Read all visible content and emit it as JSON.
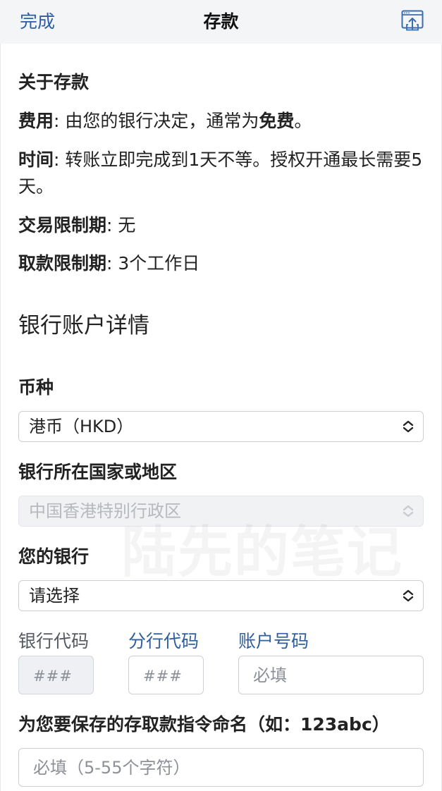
{
  "nav": {
    "done_label": "完成",
    "title": "存款",
    "share_icon": "share-icon"
  },
  "about": {
    "heading": "关于存款",
    "fee": {
      "label": "费用",
      "sep": ": ",
      "text_before": "由您的银行决定，通常为",
      "emphasis": "免费",
      "text_after": "。"
    },
    "time": {
      "label": "时间",
      "sep": ": ",
      "text": "转账立即完成到1天不等。授权开通最长需要5天。"
    },
    "trade_hold": {
      "label": "交易限制期",
      "sep": ": ",
      "text": "无"
    },
    "withdraw_hold": {
      "label": "取款限制期",
      "sep": ": ",
      "text": "3个工作日"
    }
  },
  "bank_details": {
    "heading": "银行账户详情",
    "currency": {
      "label": "币种",
      "value": "港币（HKD）"
    },
    "country": {
      "label": "银行所在国家或地区",
      "value": "中国香港特别行政区",
      "disabled": true
    },
    "bank": {
      "label": "您的银行",
      "value": "请选择"
    },
    "bank_code": {
      "label": "银行代码",
      "placeholder": "###",
      "disabled": true
    },
    "branch_code": {
      "label": "分行代码",
      "placeholder": "###"
    },
    "account_number": {
      "label": "账户号码",
      "placeholder": "必填"
    },
    "instruction_name": {
      "label": "为您要保存的存取款指令命名（如：123abc）",
      "placeholder": "必填（5-55个字符）"
    }
  },
  "watermark": "陆先的笔记",
  "colors": {
    "accent": "#2c5da6",
    "link_label": "#2f5f9f",
    "nav_background": "#f4f5f7",
    "text": "#222222",
    "disabled_text": "#b6b9bd"
  }
}
